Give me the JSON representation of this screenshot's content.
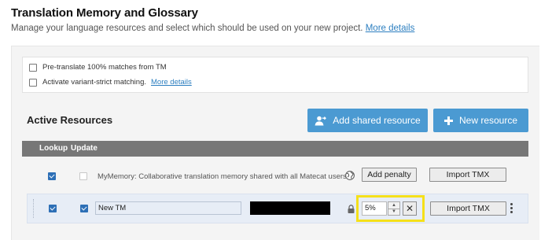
{
  "header": {
    "title": "Translation Memory and Glossary",
    "subtitle": "Manage your language resources and select which should be used on your new project.",
    "details_link": "More details"
  },
  "options": {
    "pretranslate": {
      "label": "Pre-translate 100% matches from TM",
      "checked": false
    },
    "variant_strict": {
      "label": "Activate variant-strict matching.",
      "link": "More details",
      "checked": false
    }
  },
  "resources": {
    "title": "Active Resources",
    "add_shared_label": "Add shared resource",
    "new_resource_label": "New resource",
    "columns": {
      "lookup": "Lookup",
      "update": "Update"
    },
    "rows": [
      {
        "lookup": true,
        "update": false,
        "name": "MyMemory: Collaborative translation memory shared with all Matecat users.",
        "icon": "globe-icon",
        "penalty_button": "Add penalty",
        "import_button": "Import TMX"
      },
      {
        "lookup": true,
        "update": true,
        "name": "New TM",
        "icon": "lock-icon",
        "penalty_value": "5%",
        "import_button": "Import TMX"
      }
    ]
  },
  "colors": {
    "accent": "#4b9ad2",
    "header_bar": "#777777",
    "checkbox": "#2d6fb6",
    "highlight": "#f5e01a",
    "link": "#2d7fc0"
  }
}
